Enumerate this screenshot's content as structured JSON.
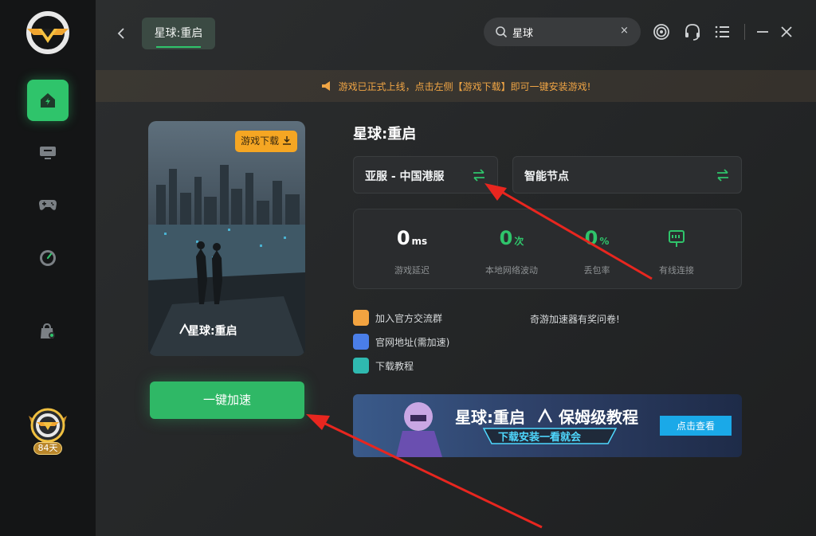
{
  "app": {
    "membership_days": "84天"
  },
  "header": {
    "game_tab": "星球:重启",
    "search": {
      "value": "星球",
      "clear": "×"
    }
  },
  "notice": {
    "text": "游戏已正式上线，点击左侧【游戏下载】即可一键安装游戏!"
  },
  "game": {
    "title": "星球:重启",
    "cover_logo": "星球:重启",
    "download_button": "游戏下载",
    "boost_button": "一键加速",
    "server": "亚服 - 中国港服",
    "node": "智能节点"
  },
  "stats": [
    {
      "value": "0",
      "unit": "ms",
      "label": "游戏延迟",
      "color": "#ffffff"
    },
    {
      "value": "0",
      "unit": "次",
      "label": "本地网络波动",
      "color": "#2fc46b"
    },
    {
      "value": "0",
      "unit": "%",
      "label": "丢包率",
      "color": "#2fc46b"
    },
    {
      "value": "",
      "unit": "",
      "label": "有线连接",
      "color": "#2fc46b"
    }
  ],
  "links": {
    "group": "加入官方交流群",
    "website": "官网地址(需加速)",
    "tutorial": "下载教程",
    "survey": "奇游加速器有奖问卷!"
  },
  "banner": {
    "title": "星球:重启",
    "subtitle": "保姆级教程",
    "tagline": "下载安装一看就会",
    "cta": "点击查看"
  },
  "colors": {
    "accent": "#2fc46b",
    "warning": "#f5a623",
    "annotation": "#e8261f"
  }
}
